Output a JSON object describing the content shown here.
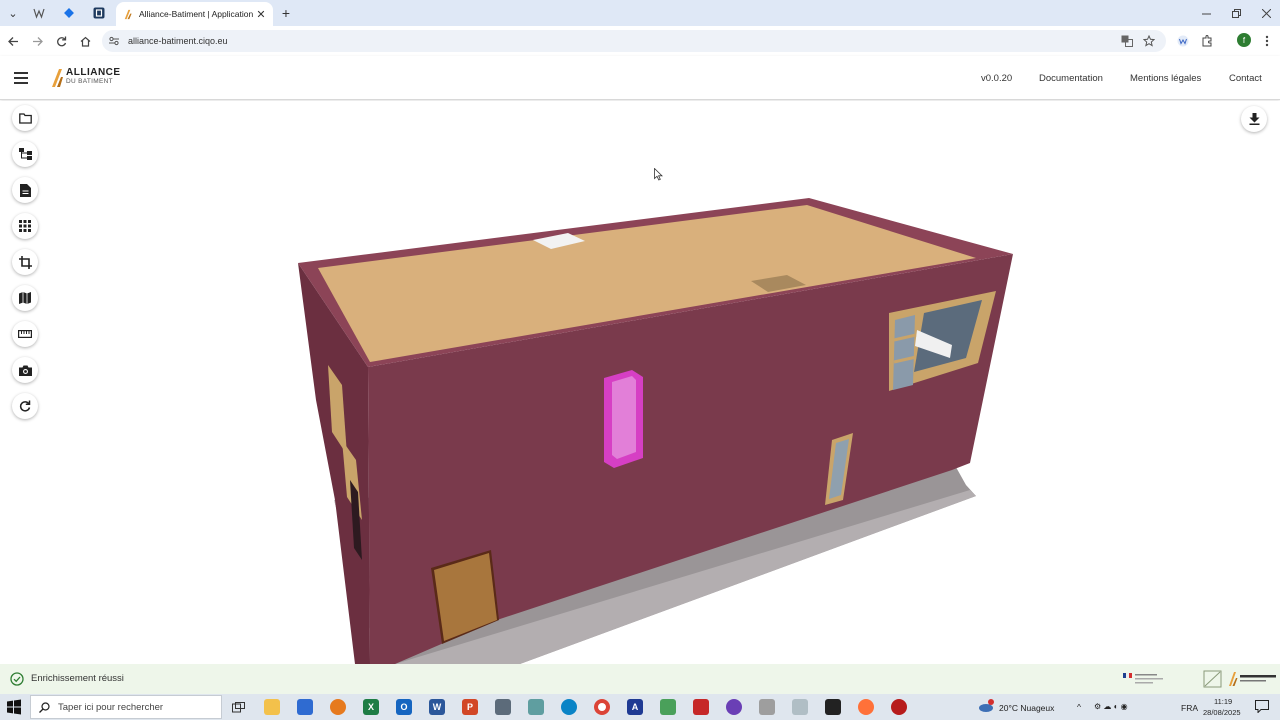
{
  "browser": {
    "active_tab_title": "Alliance-Batiment | Application",
    "new_tab_symbol": "+",
    "tab_close_symbol": "✕",
    "url": "alliance-batiment.ciqo.eu"
  },
  "header": {
    "logo": {
      "line1": "ALLIANCE",
      "line2": "DU BATIMENT"
    },
    "version": "v0.0.20",
    "links": [
      "Documentation",
      "Mentions légales",
      "Contact"
    ]
  },
  "toolbar": {
    "tools": [
      "folder-icon",
      "tree-icon",
      "document-icon",
      "grid-icon",
      "crop-icon",
      "map-icon",
      "ruler-icon",
      "camera-icon",
      "refresh-icon"
    ],
    "download": "download-icon"
  },
  "model": {
    "wall_color": "#7a3a4c",
    "roof_color": "#d9b07c",
    "base_color": "#9a9597",
    "highlight_color": "#d63fc4"
  },
  "status": {
    "message": "Enrichissement réussi",
    "color": "#2e7d32"
  },
  "taskbar": {
    "search_placeholder": "Taper ici pour rechercher",
    "weather": "20°C  Nuageux",
    "lang": "FRA",
    "time": "11:19",
    "date": "28/08/2025"
  }
}
